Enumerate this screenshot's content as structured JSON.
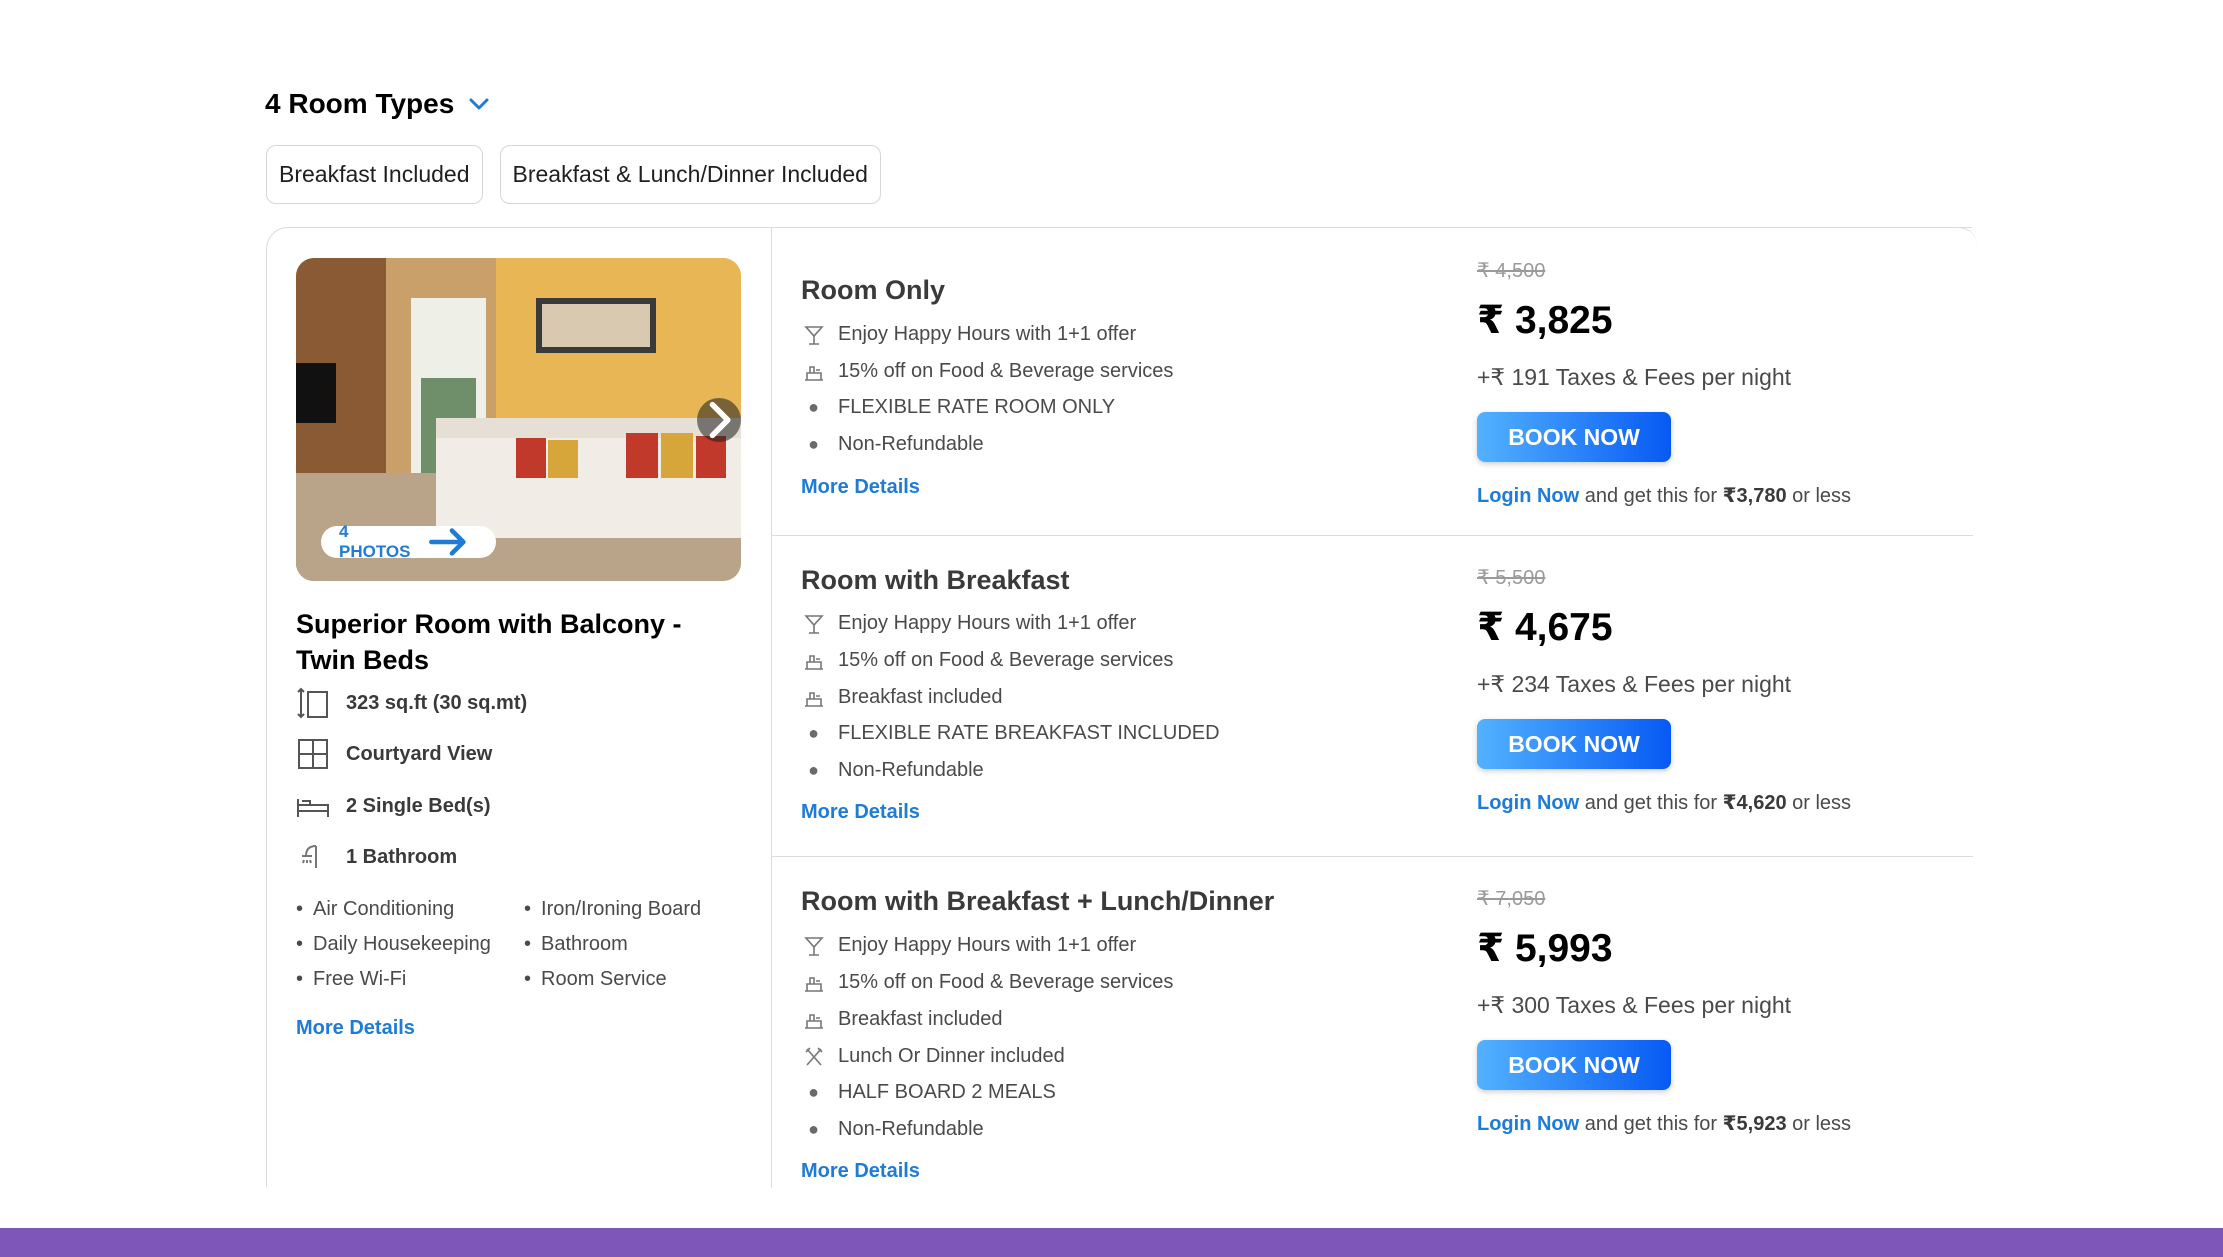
{
  "header": {
    "title": "4 Room Types"
  },
  "filters": [
    "Breakfast Included",
    "Breakfast & Lunch/Dinner Included"
  ],
  "room": {
    "photo_badge": "4 PHOTOS",
    "name": "Superior Room with Balcony - Twin Beds",
    "size": "323 sq.ft (30 sq.mt)",
    "view": "Courtyard View",
    "beds": "2 Single Bed(s)",
    "bathroom": "1 Bathroom",
    "amenities": [
      "Air Conditioning",
      "Iron/Ironing Board",
      "Daily Housekeeping",
      "Bathroom",
      "Free Wi-Fi",
      "Room Service"
    ],
    "more_details": "More Details"
  },
  "plans": [
    {
      "title": "Room Only",
      "features": [
        {
          "icon": "cocktail-icon",
          "text": "Enjoy Happy Hours with 1+1 offer"
        },
        {
          "icon": "food-tray-icon",
          "text": "15% off on Food & Beverage services"
        },
        {
          "icon": "bullet",
          "text": "FLEXIBLE RATE ROOM ONLY"
        },
        {
          "icon": "bullet",
          "text": "Non-Refundable"
        }
      ],
      "more_details": "More Details",
      "old_price": "₹ 4,500",
      "price": "₹ 3,825",
      "taxes": "+₹ 191 Taxes & Fees per night",
      "book": "BOOK NOW",
      "login_link": "Login Now",
      "login_text": " and get this for ",
      "login_price": "₹3,780",
      "login_suffix": " or less"
    },
    {
      "title": "Room with Breakfast",
      "features": [
        {
          "icon": "cocktail-icon",
          "text": "Enjoy Happy Hours with 1+1 offer"
        },
        {
          "icon": "food-tray-icon",
          "text": "15% off on Food & Beverage services"
        },
        {
          "icon": "food-tray-icon",
          "text": "Breakfast included"
        },
        {
          "icon": "bullet",
          "text": "FLEXIBLE RATE BREAKFAST INCLUDED"
        },
        {
          "icon": "bullet",
          "text": "Non-Refundable"
        }
      ],
      "more_details": "More Details",
      "old_price": "₹ 5,500",
      "price": "₹ 4,675",
      "taxes": "+₹ 234 Taxes & Fees per night",
      "book": "BOOK NOW",
      "login_link": "Login Now",
      "login_text": " and get this for ",
      "login_price": "₹4,620",
      "login_suffix": " or less"
    },
    {
      "title": "Room with Breakfast + Lunch/Dinner",
      "features": [
        {
          "icon": "cocktail-icon",
          "text": "Enjoy Happy Hours with 1+1 offer"
        },
        {
          "icon": "food-tray-icon",
          "text": "15% off on Food & Beverage services"
        },
        {
          "icon": "food-tray-icon",
          "text": "Breakfast included"
        },
        {
          "icon": "cutlery-icon",
          "text": "Lunch Or Dinner included"
        },
        {
          "icon": "bullet",
          "text": "HALF BOARD 2 MEALS"
        },
        {
          "icon": "bullet",
          "text": "Non-Refundable"
        }
      ],
      "more_details": "More Details",
      "old_price": "₹ 7,050",
      "price": "₹ 5,993",
      "taxes": "+₹ 300 Taxes & Fees per night",
      "book": "BOOK NOW",
      "login_link": "Login Now",
      "login_text": " and get this for ",
      "login_price": "₹5,923",
      "login_suffix": " or less"
    }
  ],
  "colors": {
    "link": "#1e7bd6",
    "book_start": "#53b2fe",
    "book_end": "#065af3",
    "footer": "#7e55b8"
  }
}
